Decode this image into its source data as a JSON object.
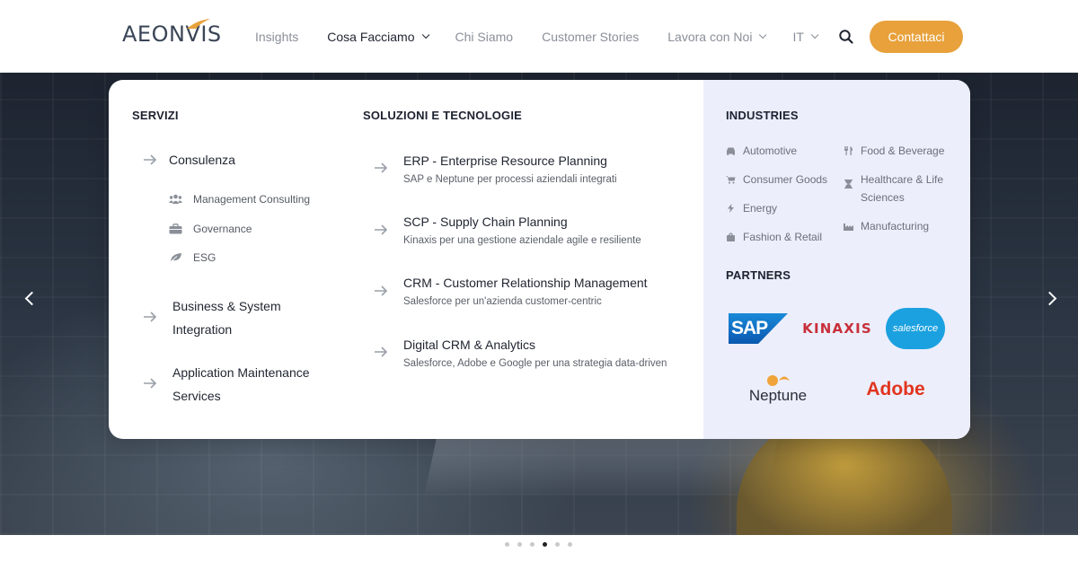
{
  "header": {
    "logo": "AEONVIS",
    "nav": [
      {
        "label": "Insights",
        "chevron": false,
        "active": false
      },
      {
        "label": "Cosa Facciamo",
        "chevron": true,
        "active": true
      },
      {
        "label": "Chi Siamo",
        "chevron": false,
        "active": false
      },
      {
        "label": "Customer Stories",
        "chevron": false,
        "active": false
      },
      {
        "label": "Lavora con Noi",
        "chevron": true,
        "active": false
      },
      {
        "label": "IT",
        "chevron": true,
        "active": false
      }
    ],
    "cta_label": "Contattaci"
  },
  "colors": {
    "accent": "#e8a13b",
    "industries_bg": "#eceefb"
  },
  "mega_menu": {
    "servizi": {
      "title": "SERVIZI",
      "consulenza": "Consulenza",
      "sub_items": [
        {
          "label": "Management Consulting",
          "icon": "users-icon"
        },
        {
          "label": "Governance",
          "icon": "briefcase-icon"
        },
        {
          "label": "ESG",
          "icon": "leaf-icon"
        }
      ],
      "bsi_line1": "Business & System",
      "bsi_line2": "Integration",
      "ams_line1": "Application Maintenance",
      "ams_line2": "Services"
    },
    "soluzioni": {
      "title": "SOLUZIONI E TECNOLOGIE",
      "items": [
        {
          "title": "ERP - Enterprise Resource Planning",
          "desc": "SAP e Neptune per processi aziendali integrati"
        },
        {
          "title": "SCP - Supply Chain Planning",
          "desc": "Kinaxis per una gestione aziendale agile e resiliente"
        },
        {
          "title": "CRM - Customer Relationship Management",
          "desc": "Salesforce per un'azienda customer-centric"
        },
        {
          "title": "Digital CRM & Analytics",
          "desc": "Salesforce, Adobe e Google per una strategia data-driven"
        }
      ]
    },
    "industries": {
      "title": "INDUSTRIES",
      "left": [
        {
          "label": "Automotive",
          "icon": "car-icon"
        },
        {
          "label": "Consumer Goods",
          "icon": "cart-icon"
        },
        {
          "label": "Energy",
          "icon": "bolt-icon"
        },
        {
          "label": "Fashion & Retail",
          "icon": "bag-icon"
        }
      ],
      "right": [
        {
          "label": "Food & Beverage",
          "icon": "fork-knife-icon"
        },
        {
          "label": "Healthcare & Life Sciences",
          "icon": "hourglass-icon"
        },
        {
          "label": "Manufacturing",
          "icon": "industry-icon"
        }
      ]
    },
    "partners": {
      "title": "PARTNERS",
      "sap": "SAP",
      "kinaxis": "KINAXIS",
      "salesforce": "salesforce",
      "neptune": "Neptune",
      "adobe": "Adobe"
    }
  },
  "carousel": {
    "dot_count": 6,
    "active_index": 3
  }
}
